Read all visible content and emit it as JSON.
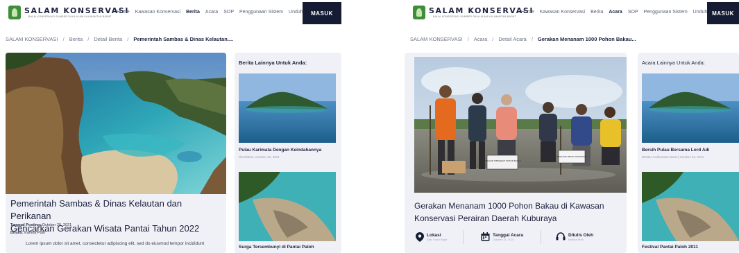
{
  "left": {
    "brand": {
      "title": "SALAM KONSERVASI",
      "subtitle": "BALAI KONSERVASI SUMBER DAYA ALAM KALIMANTAN BARAT"
    },
    "nav": [
      "Home",
      "Kawasan Konservasi",
      "Berita",
      "Acara",
      "SOP",
      "Penggunaan Sistem",
      "Unduh"
    ],
    "nav_active": "Berita",
    "login": "MASUK",
    "breadcrumb": [
      "SALAM KONSERVASI",
      "Berita",
      "Detail Berita",
      "Pemerintah Sambas & Dinas Kelautan...."
    ],
    "article": {
      "title_line1": "Pemerintah Sambas & Dinas Kelautan dan Perikanan",
      "title_line2": "Gencarkan Gerakan Wisata Pantai Tahun 2022",
      "posted_label": "Tanggal Posting:",
      "posted_value": "October 20, 2021",
      "author_label": "Ditulis:",
      "author_value": "Karlina Putri",
      "body": "Lorem ipsum dolor sit amet, consectetur adipiscing elit, sed do eiusmod tempor incididunt"
    },
    "sidebar": {
      "title": "Berita Lainnya Untuk Anda:",
      "items": [
        {
          "caption": "Pulau Karimata Dengan Keindahannya",
          "date": "Diterbitkan: October 20, 2021"
        },
        {
          "caption": "Surga Tersembunyi di Pantai Paloh",
          "date": ""
        }
      ]
    }
  },
  "right": {
    "brand": {
      "title": "SALAM KONSERVASI",
      "subtitle": "BALAI KONSERVASI SUMBER DAYA ALAM KALIMANTAN BARAT"
    },
    "nav": [
      "Home",
      "Kawasan Konservasi",
      "Berita",
      "Acara",
      "SOP",
      "Penggunaan Sistem",
      "Unduh"
    ],
    "nav_active": "Acara",
    "login": "MASUK",
    "breadcrumb": [
      "SALAM KONSERVASI",
      "Acara",
      "Detail Acara",
      "Gerakan Menanam 1000 Pohon Bakau..."
    ],
    "event": {
      "title_line1": "Gerakan Menanam 1000 Pohon Bakau di Kawasan",
      "title_line2": "Konservasi Perairan Daerah Kuburaya",
      "location_label": "Lokasi",
      "location_value": "Kab. Kubu Raya",
      "date_label": "Tanggal Acara",
      "date_value": "October 21, 2021",
      "author_label": "Ditulis Oleh",
      "author_value": "Karlina Putri",
      "sign_1": "GERAKAN MENANAM POHON BAKAU",
      "sign_2": "BERSAMA BPSPL PONTIANAK"
    },
    "sidebar": {
      "title": "Acara Lainnya Untuk Anda:",
      "items": [
        {
          "caption": "Bersih Pulau Bersama Lord Adi",
          "date": "BKSDA Kalimantan Barat  |  October 23, 2021"
        },
        {
          "caption": "Festival Pantai Paloh 2011",
          "date": ""
        }
      ]
    }
  },
  "colors": {
    "navy": "#141b33",
    "card": "#f0f1f7",
    "brand_green": "#3f8f3a",
    "text_dark": "#1c2340"
  }
}
